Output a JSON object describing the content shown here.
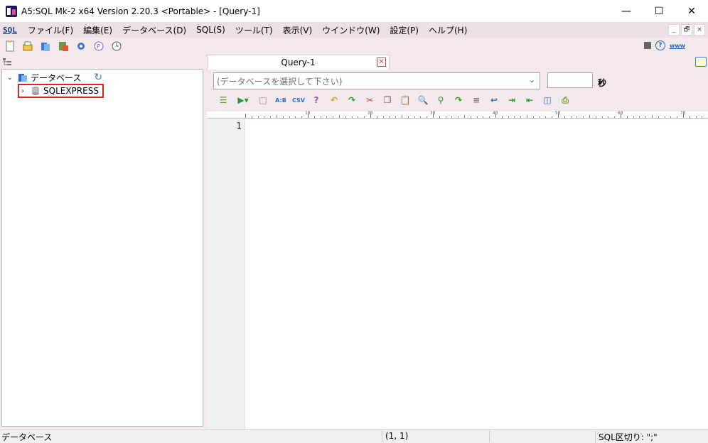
{
  "window": {
    "title": "A5:SQL Mk-2 x64 Version 2.20.3 <Portable> - [Query-1]",
    "minimize": "—",
    "maximize": "☐",
    "close": "✕"
  },
  "menubar": {
    "sql_icon_text": "SQL",
    "items": [
      {
        "label": "ファイル(F)"
      },
      {
        "label": "編集(E)"
      },
      {
        "label": "データベース(D)"
      },
      {
        "label": "SQL(S)"
      },
      {
        "label": "ツール(T)"
      },
      {
        "label": "表示(V)"
      },
      {
        "label": "ウインドウ(W)"
      },
      {
        "label": "設定(P)"
      },
      {
        "label": "ヘルプ(H)"
      }
    ],
    "mdi_minimize": "_",
    "mdi_restore": "🗗",
    "mdi_close": "×"
  },
  "toolbar": {
    "www_label": "www"
  },
  "tree": {
    "root_label": "データベース",
    "child_label": "SQLEXPRESS"
  },
  "query_tab": {
    "label": "Query-1",
    "close": "✕"
  },
  "query_bar": {
    "db_placeholder": "(データベースを選択して下さい)",
    "timeout_unit": "秒"
  },
  "ruler": {
    "labels": [
      "10",
      "20",
      "30",
      "40",
      "50",
      "60",
      "70"
    ]
  },
  "editor": {
    "line_number": "1"
  },
  "statusbar": {
    "left": "データベース",
    "position": "(1, 1)",
    "delimiter": "SQL区切り: \";\""
  },
  "colors": {
    "accent_pink": "#f3e9ec",
    "highlight_red": "#e02020"
  }
}
